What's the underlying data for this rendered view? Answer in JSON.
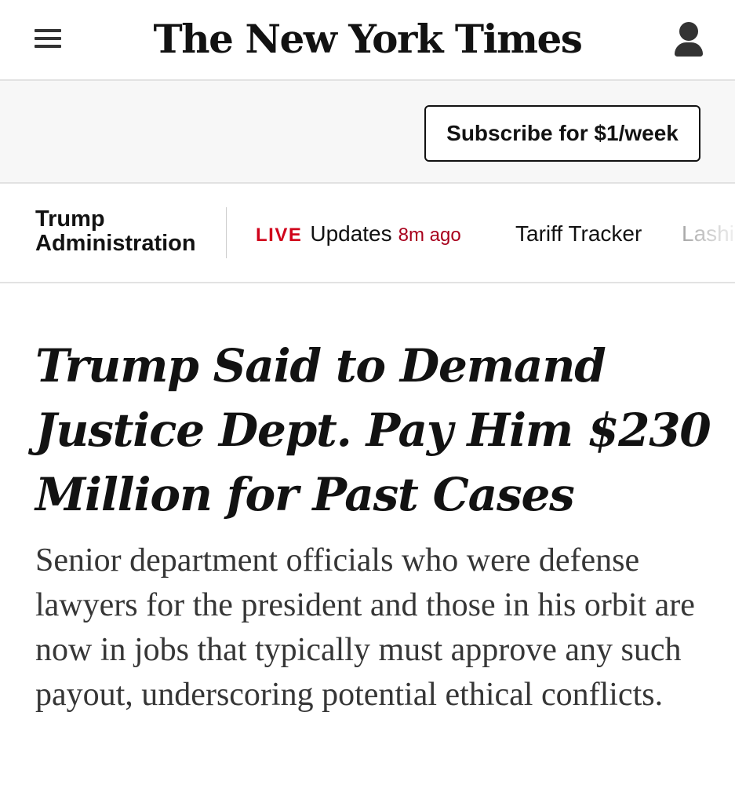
{
  "masthead": {
    "logo_text": "The New York Times",
    "menu_icon": "hamburger-menu-icon",
    "account_icon": "user-account-icon"
  },
  "subscribe": {
    "button_label": "Subscribe for $1/week"
  },
  "section_nav": {
    "section_title": "Trump Administration",
    "live": {
      "tag": "LIVE",
      "label": "Updates",
      "time": "8m ago"
    },
    "links": [
      {
        "label": "Tariff Tracker"
      },
      {
        "label": "Lashi"
      }
    ]
  },
  "article": {
    "headline": "Trump Said to Demand Justice Dept. Pay Him $230 Million for Past Cases",
    "summary": "Senior department officials who were defense lawyers for the president and those in his orbit are now in jobs that typically must approve any such payout, underscoring potential ethical conflicts."
  },
  "colors": {
    "live_red": "#d0021b",
    "time_red": "#a8001c",
    "text": "#121212",
    "summary_text": "#363636",
    "subscribe_bar_bg": "#f7f7f7",
    "divider": "#e2e2e2"
  }
}
